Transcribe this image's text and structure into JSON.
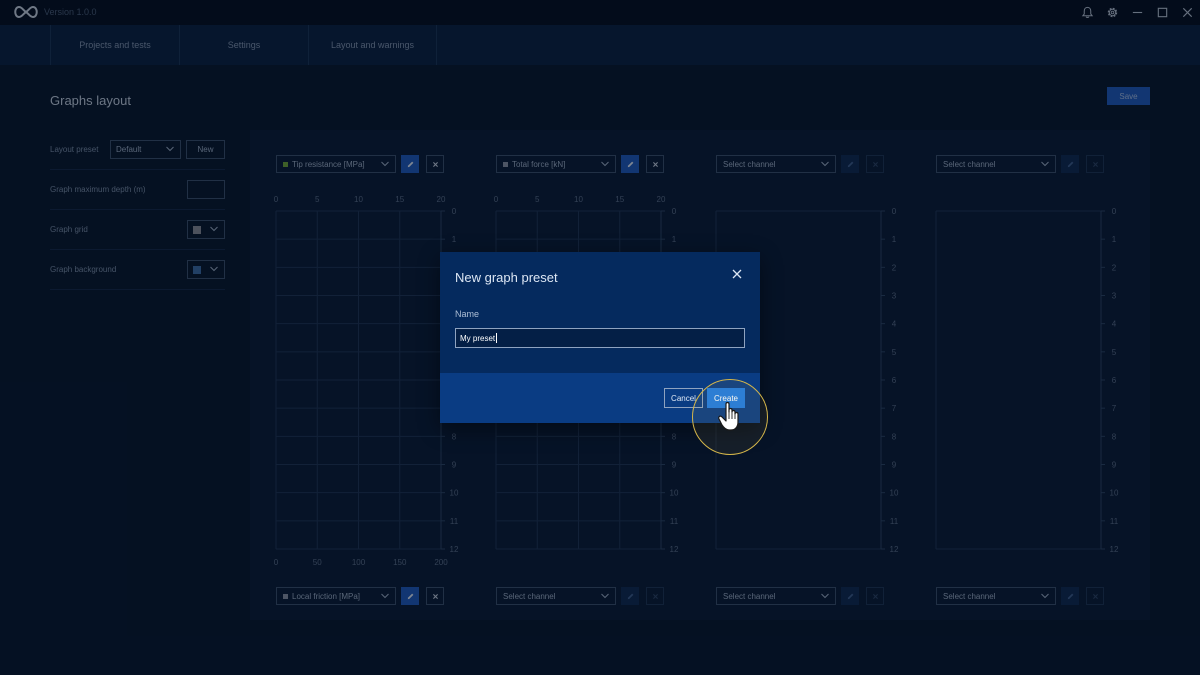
{
  "app": {
    "version": "Version 1.0.0"
  },
  "nav": {
    "items": [
      "Projects and tests",
      "Settings",
      "Layout and warnings"
    ]
  },
  "page": {
    "title": "Graphs layout",
    "save_label": "Save"
  },
  "settings": {
    "layout_preset_label": "Layout preset",
    "layout_preset_value": "Default",
    "new_label": "New",
    "max_depth_label": "Graph maximum depth (m)",
    "max_depth_value": "",
    "grid_label": "Graph grid",
    "grid_color": "#8a8f99",
    "background_label": "Graph background",
    "background_color": "#3d6ea8"
  },
  "graphs": {
    "top_channels": [
      {
        "label": "Tip resistance [MPa]",
        "dot": "#6fa83a",
        "assigned": true
      },
      {
        "label": "Total force [kN]",
        "dot": "#8a94a6",
        "assigned": true
      },
      {
        "label": "Select channel",
        "dot": "",
        "assigned": false
      },
      {
        "label": "Select channel",
        "dot": "",
        "assigned": false
      }
    ],
    "bottom_channels": [
      {
        "label": "Local friction [MPa]",
        "dot": "#8a94a6",
        "assigned": true
      },
      {
        "label": "Select channel",
        "dot": "",
        "assigned": false
      },
      {
        "label": "Select channel",
        "dot": "",
        "assigned": false
      },
      {
        "label": "Select channel",
        "dot": "",
        "assigned": false
      }
    ],
    "top_axis_ticks": [
      "0",
      "5",
      "10",
      "15",
      "20"
    ],
    "bottom_axis_ticks": [
      "0",
      "50",
      "100",
      "150",
      "200"
    ],
    "depth_ticks": [
      "0",
      "1",
      "2",
      "3",
      "4",
      "5",
      "6",
      "7",
      "8",
      "9",
      "10",
      "11",
      "12"
    ]
  },
  "modal": {
    "title": "New graph preset",
    "name_label": "Name",
    "name_value": "My preset",
    "cancel_label": "Cancel",
    "create_label": "Create"
  },
  "colors": {
    "accent": "#1f7ae0",
    "click_highlight": "#d6b74a"
  }
}
